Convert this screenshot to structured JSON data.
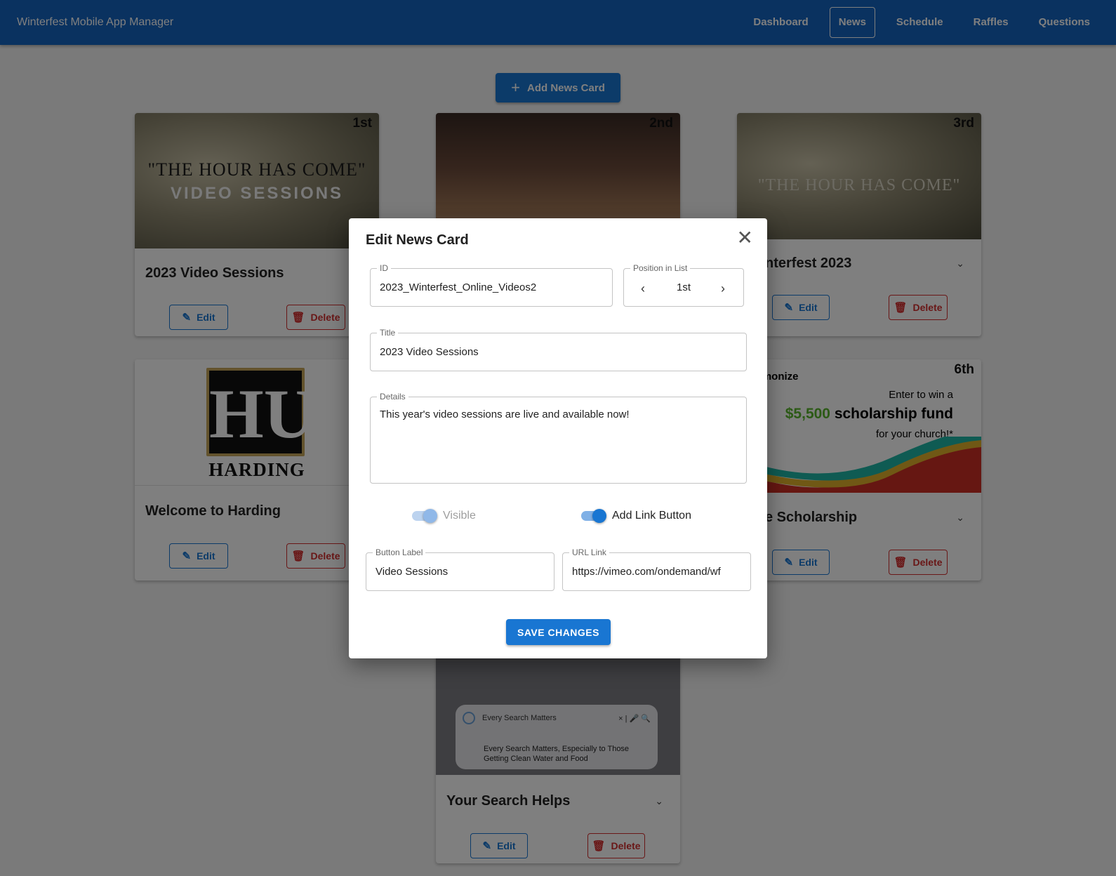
{
  "app": {
    "title": "Winterfest Mobile App Manager"
  },
  "nav": {
    "items": [
      {
        "label": "Dashboard",
        "active": false
      },
      {
        "label": "News",
        "active": true
      },
      {
        "label": "Schedule",
        "active": false
      },
      {
        "label": "Raffles",
        "active": false
      },
      {
        "label": "Questions",
        "active": false
      }
    ]
  },
  "add_button": {
    "label": "Add News Card"
  },
  "cards": [
    {
      "rank": "1st",
      "title": "2023 Video Sessions",
      "image_line1": "\"THE HOUR HAS COME\"",
      "image_line2": "VIDEO SESSIONS",
      "edit": "Edit",
      "delete": "Delete"
    },
    {
      "rank": "2nd"
    },
    {
      "rank": "3rd",
      "title": "nterfest 2023",
      "image_line1": "\"THE HOUR HAS COME\"",
      "edit": "Edit",
      "delete": "Delete"
    },
    {
      "title": "Welcome to Harding",
      "logo": "HU",
      "logo_text": "HARDING",
      "edit": "Edit",
      "delete": "Delete"
    },
    {
      "rank": "6th",
      "title": "e Scholarship",
      "t1": "rmonize",
      "t2": "Enter to win a",
      "money": "$5,500",
      "t3": " scholarship fund",
      "t4": "for your church!*",
      "edit": "Edit",
      "delete": "Delete"
    },
    {
      "title": "Your Search Helps",
      "search_text": "Every Search Matters",
      "search_sub": "Every Search Matters, Especially to Those Getting Clean Water and Food",
      "edit": "Edit",
      "delete": "Delete"
    }
  ],
  "dialog": {
    "title": "Edit News Card",
    "id_label": "ID",
    "id_value": "2023_Winterfest_Online_Videos2",
    "position_label": "Position in List",
    "position_value": "1st",
    "title_label": "Title",
    "title_value": "2023 Video Sessions",
    "details_label": "Details",
    "details_value": "This year's video sessions are live and available now!",
    "visible_label": "Visible",
    "visible_on": true,
    "visible_disabled": true,
    "link_label": "Add Link Button",
    "link_on": true,
    "button_label_label": "Button Label",
    "button_label_value": "Video Sessions",
    "url_label": "URL Link",
    "url_value": "https://vimeo.com/ondemand/wf",
    "save_label": "SAVE CHANGES"
  },
  "colors": {
    "primary": "#1565c0",
    "button": "#1976d2",
    "danger": "#d32f2f"
  }
}
